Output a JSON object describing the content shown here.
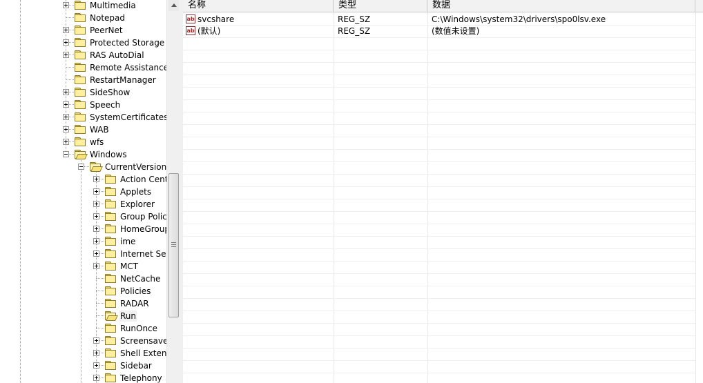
{
  "tree": {
    "items": [
      {
        "label": "Multimedia",
        "expander": true
      },
      {
        "label": "Notepad",
        "expander": false
      },
      {
        "label": "PeerNet",
        "expander": true
      },
      {
        "label": "Protected Storage S",
        "expander": true
      },
      {
        "label": "RAS AutoDial",
        "expander": true
      },
      {
        "label": "Remote Assistance",
        "expander": false
      },
      {
        "label": "RestartManager",
        "expander": false
      },
      {
        "label": "SideShow",
        "expander": true
      },
      {
        "label": "Speech",
        "expander": true
      },
      {
        "label": "SystemCertificates",
        "expander": true
      },
      {
        "label": "WAB",
        "expander": true
      },
      {
        "label": "wfs",
        "expander": true
      },
      {
        "label": "Windows",
        "expander": "minus"
      },
      {
        "label": "CurrentVersion",
        "expander": "minus"
      },
      {
        "label": "Action Cent",
        "expander": true
      },
      {
        "label": "Applets",
        "expander": true
      },
      {
        "label": "Explorer",
        "expander": true
      },
      {
        "label": "Group Polic",
        "expander": true
      },
      {
        "label": "HomeGroup",
        "expander": true
      },
      {
        "label": "ime",
        "expander": true
      },
      {
        "label": "Internet Se",
        "expander": true
      },
      {
        "label": "MCT",
        "expander": true
      },
      {
        "label": "NetCache",
        "expander": false
      },
      {
        "label": "Policies",
        "expander": false
      },
      {
        "label": "RADAR",
        "expander": false
      },
      {
        "label": "Run",
        "expander": false,
        "selected": true
      },
      {
        "label": "RunOnce",
        "expander": false
      },
      {
        "label": "Screensave",
        "expander": true
      },
      {
        "label": "Shell Extens",
        "expander": true
      },
      {
        "label": "Sidebar",
        "expander": true
      },
      {
        "label": "Telephony",
        "expander": true
      }
    ]
  },
  "list": {
    "columns": [
      "名称",
      "类型",
      "数据"
    ],
    "rows": [
      {
        "name": "svcshare",
        "type": "REG_SZ",
        "data": "C:\\Windows\\system32\\drivers\\spo0lsv.exe"
      },
      {
        "name": "(默认)",
        "type": "REG_SZ",
        "data": "(数值未设置)"
      }
    ],
    "value_icon": "string-value-icon"
  },
  "colors": {
    "folder": "#fff0a0",
    "selection": "#f0f0f0",
    "header": "#f2f2f2"
  }
}
